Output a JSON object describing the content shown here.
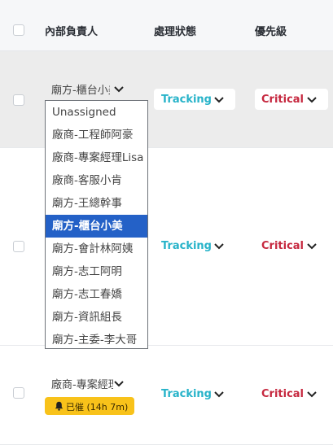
{
  "header": {
    "col_owner": "內部負責人",
    "col_status": "處理狀態",
    "col_priority": "優先級"
  },
  "rows": [
    {
      "owner": "廟方-櫃台小美",
      "status": "Tracking",
      "priority": "Critical"
    },
    {
      "owner": "",
      "status": "Tracking",
      "priority": "Critical"
    },
    {
      "owner": "廠商-專案經理Lisa",
      "status": "Tracking",
      "priority": "Critical",
      "reminder_badge": "已催 (14h 7m)"
    }
  ],
  "dropdown": {
    "selected_index": 5,
    "options": [
      "Unassigned",
      "廠商-工程師阿豪",
      "廠商-專案經理Lisa",
      "廠商-客服小肯",
      "廟方-王總幹事",
      "廟方-櫃台小美",
      "廟方-會計林阿姨",
      "廟方-志工阿明",
      "廟方-志工春嬌",
      "廟方-資訊組長",
      "廟方-主委-李大哥"
    ]
  },
  "colors": {
    "status": "#27b3c9",
    "priority": "#c6283f",
    "selected_option": "#2461c7",
    "badge": "#f8c21a"
  },
  "icons": [
    "chevron-down-icon",
    "bell-icon"
  ]
}
